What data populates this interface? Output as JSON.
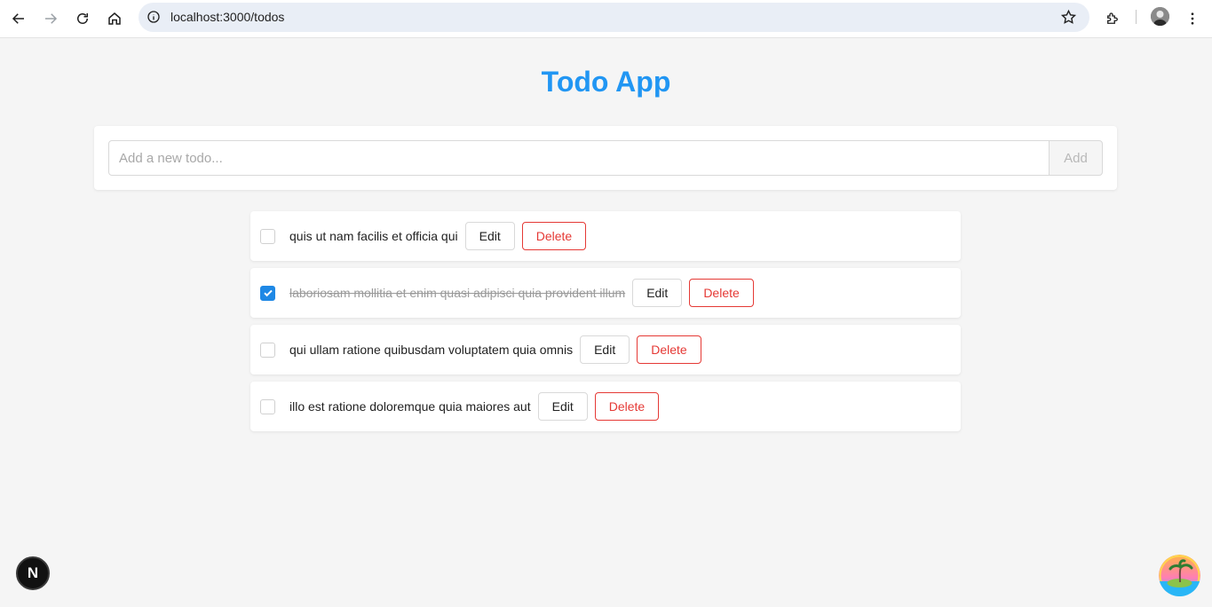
{
  "browser": {
    "url": "localhost:3000/todos"
  },
  "app": {
    "title": "Todo App",
    "input": {
      "value": "",
      "placeholder": "Add a new todo..."
    },
    "add_label": "Add",
    "edit_label": "Edit",
    "delete_label": "Delete",
    "todos": [
      {
        "text": "quis ut nam facilis et officia qui",
        "completed": false
      },
      {
        "text": "laboriosam mollitia et enim quasi adipisci quia provident illum",
        "completed": true
      },
      {
        "text": "qui ullam ratione quibusdam voluptatem quia omnis",
        "completed": false
      },
      {
        "text": "illo est ratione doloremque quia maiores aut",
        "completed": false
      }
    ]
  },
  "devtools": {
    "badge_letter": "N"
  },
  "colors": {
    "title": "#2196f3",
    "checkbox_checked": "#1e88e5",
    "delete": "#e53935"
  }
}
